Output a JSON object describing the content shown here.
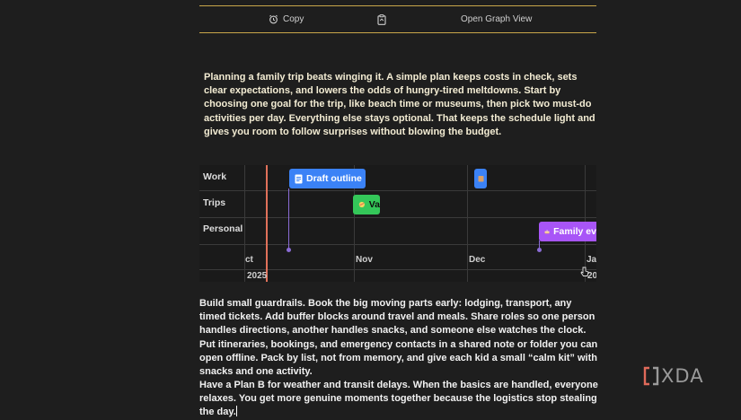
{
  "toolbar": {
    "copy_label": "Copy",
    "graph_label": "Open Graph View"
  },
  "intro": "Planning a family trip beats winging it. A simple plan keeps costs in check, sets clear expectations, and lowers the odds of hungry-tired meltdowns. Start by choosing one goal for the trip, like beach time or museums, then pick two must-do activities per day. Everything else stays optional. That keeps the schedule light and gives you room to follow surprises without blowing the budget.",
  "timeline": {
    "rows": [
      "Work",
      "Trips",
      "Personal"
    ],
    "events": {
      "draft": "Draft outline",
      "green": "Va",
      "family": "Family ev"
    },
    "months": {
      "oct": "ct",
      "nov": "Nov",
      "dec": "Dec",
      "jan": "Ja"
    },
    "years": {
      "y2025": "2025",
      "y20": "20"
    },
    "colors": {
      "today_line": "#e0715a",
      "work_event": "#3b82f6",
      "trip_event": "#34c759",
      "personal_event": "#a855f7"
    }
  },
  "body": {
    "p1": "Build small guardrails. Book the big moving parts early: lodging, transport, any timed tickets. Add buffer blocks around travel and meals. Share roles so one person handles directions, another handles snacks, and someone else watches the clock. Put itineraries, bookings, and emergency contacts in a shared note or folder you can open offline. Pack by list, not from memory, and give each kid a small “calm kit” with snacks and one activity.",
    "p2": "Have a Plan B for weather and transit delays. When the basics are handled, everyone relaxes. You get more genuine moments together because the logistics stop stealing the day."
  },
  "watermark": {
    "text": "XDA"
  }
}
